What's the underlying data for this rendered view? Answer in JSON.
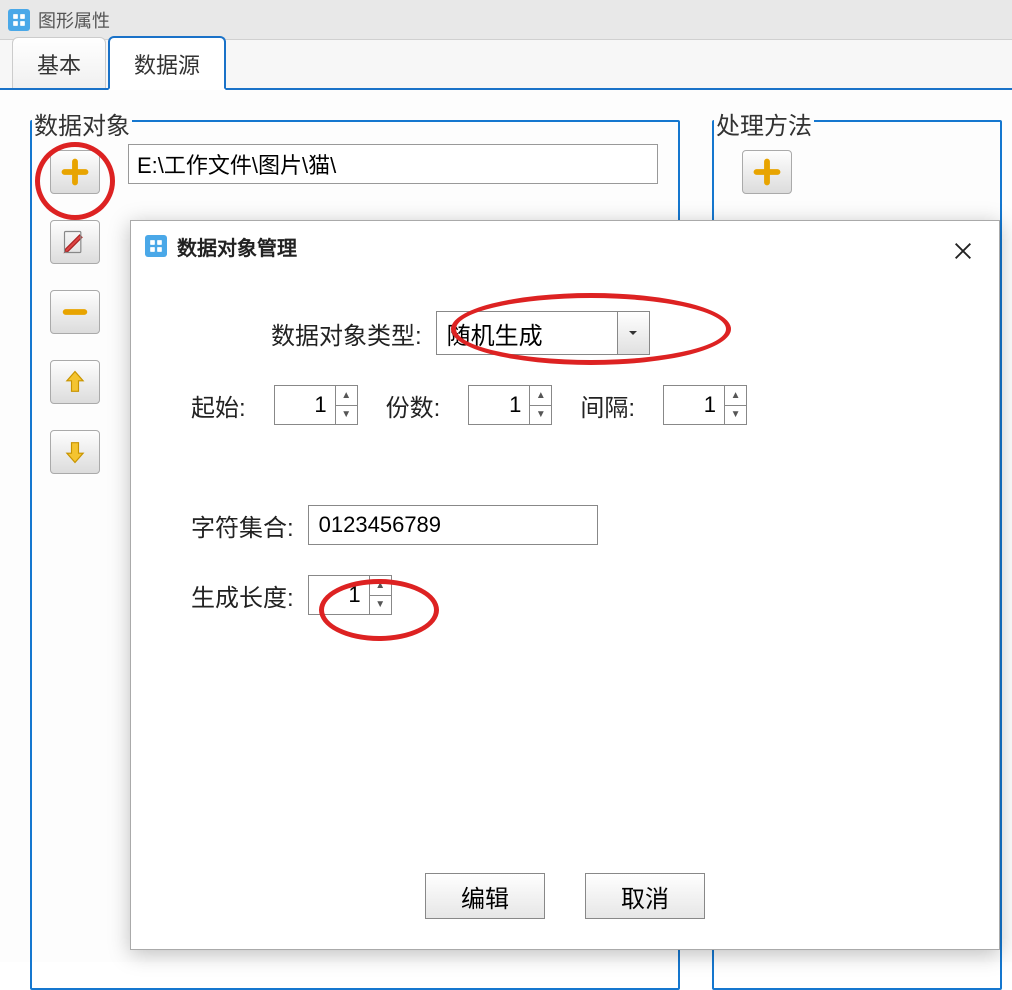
{
  "titlebar": {
    "title": "图形属性"
  },
  "tabs": {
    "basic": "基本",
    "datasource": "数据源"
  },
  "groups": {
    "data_object": "数据对象",
    "processing": "处理方法"
  },
  "data_object": {
    "path_value": "E:\\工作文件\\图片\\猫\\"
  },
  "modal": {
    "title": "数据对象管理",
    "type_label": "数据对象类型:",
    "type_value": "随机生成",
    "start_label": "起始:",
    "start_value": "1",
    "copies_label": "份数:",
    "copies_value": "1",
    "interval_label": "间隔:",
    "interval_value": "1",
    "charset_label": "字符集合:",
    "charset_value": "0123456789",
    "length_label": "生成长度:",
    "length_value": "1",
    "edit_btn": "编辑",
    "cancel_btn": "取消"
  }
}
